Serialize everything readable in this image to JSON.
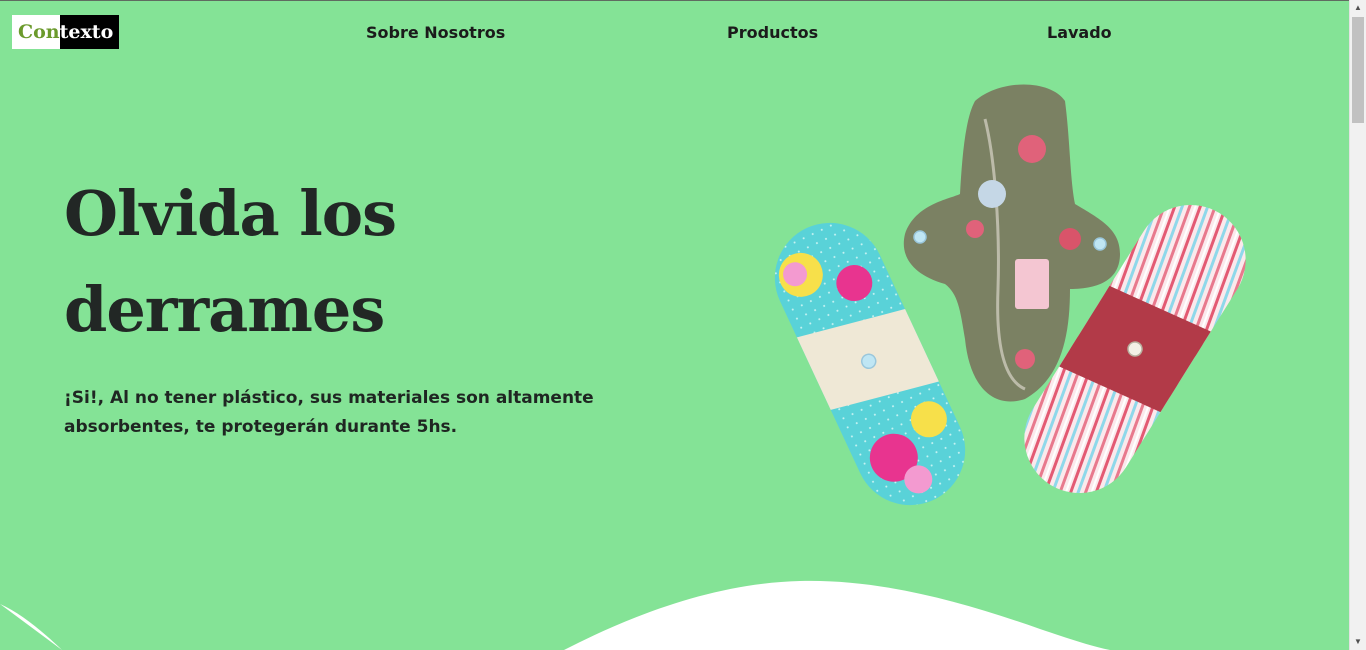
{
  "logo": {
    "part1": "Con",
    "part2": "texto"
  },
  "nav": {
    "about": "Sobre Nosotros",
    "products": "Productos",
    "washing": "Lavado"
  },
  "hero": {
    "headline_line1": "Olvida los",
    "headline_line2": "derrames",
    "subtitle_line1": "¡Si!, Al no tener plástico, sus materiales son altamente",
    "subtitle_line2": "absorbentes, te protegerán durante 5hs."
  },
  "colors": {
    "background": "#84e396",
    "logo_accent": "#6b9a2c",
    "text": "#222725"
  },
  "icons": {
    "scroll_up": "triangle-up-icon",
    "scroll_down": "triangle-down-icon"
  }
}
